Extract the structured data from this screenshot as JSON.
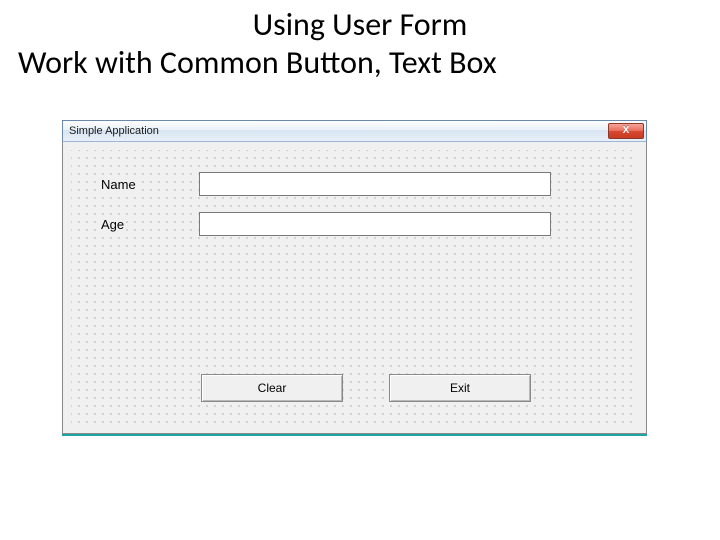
{
  "slide": {
    "title_line1": "Using User Form",
    "title_line2": "Work with Common Button, Text Box"
  },
  "window": {
    "title": "Simple Application",
    "close_symbol": "X"
  },
  "form": {
    "labels": {
      "name": "Name",
      "age": "Age"
    },
    "fields": {
      "name_value": "",
      "age_value": ""
    },
    "buttons": {
      "clear": "Clear",
      "exit": "Exit"
    }
  },
  "colors": {
    "accent": "#1aa6a6"
  }
}
